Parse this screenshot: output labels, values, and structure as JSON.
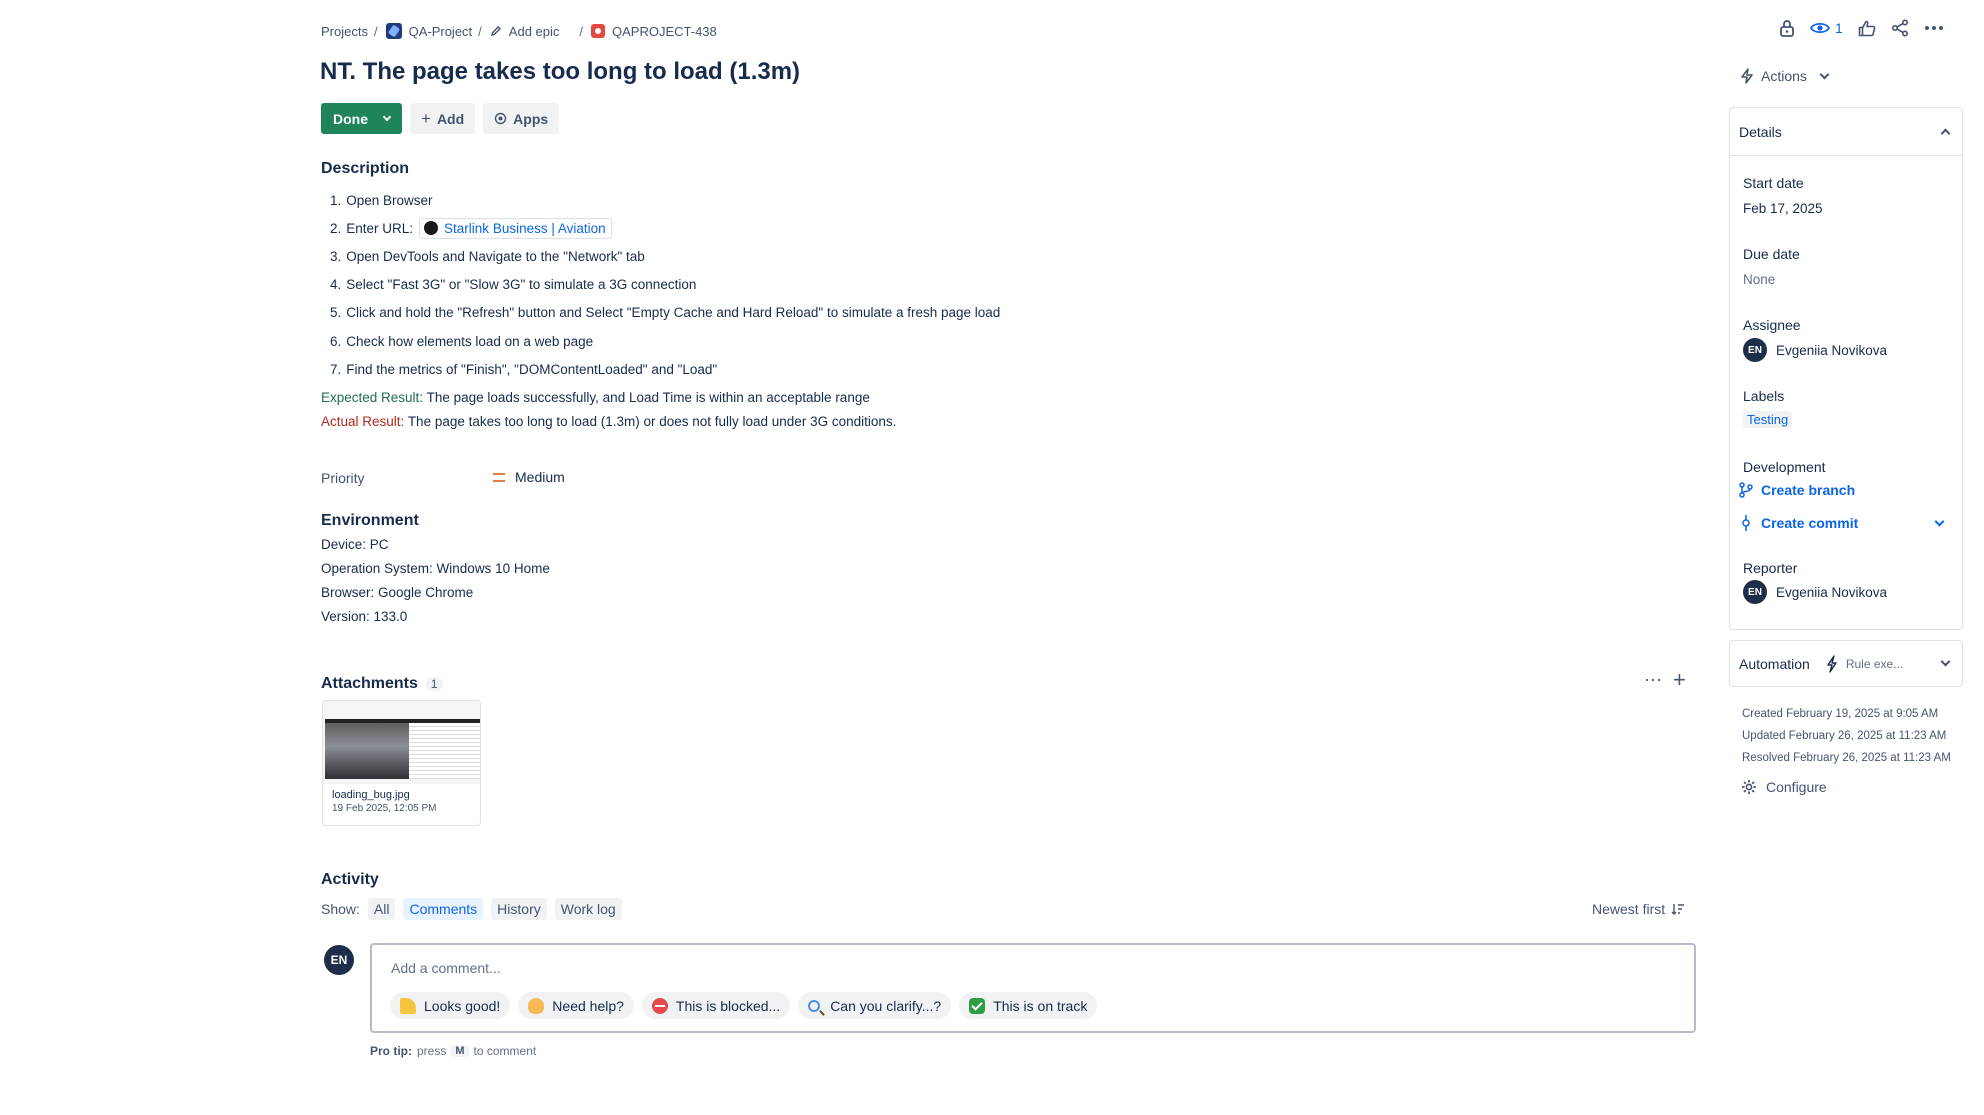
{
  "breadcrumb": {
    "projects": "Projects",
    "sep": "/",
    "project": "QA-Project",
    "add_epic": "Add epic",
    "issue_key": "QAPROJECT-438"
  },
  "issue": {
    "title": "NT. The page takes too long to load (1.3m)",
    "status": "Done",
    "add_label": "Add",
    "apps_label": "Apps"
  },
  "description": {
    "heading": "Description",
    "steps": [
      {
        "num": "1.",
        "text": "Open Browser"
      },
      {
        "num": "2.",
        "text": "Enter URL:",
        "link": "Starlink Business | Aviation"
      },
      {
        "num": "3.",
        "text": "Open DevTools and Navigate to the \"Network\" tab"
      },
      {
        "num": "4.",
        "text": "Select \"Fast 3G\" or \"Slow 3G\" to simulate a 3G connection"
      },
      {
        "num": "5.",
        "text": "Click and hold the \"Refresh\" button and Select \"Empty Cache and Hard Reload\" to simulate a fresh page load"
      },
      {
        "num": "6.",
        "text": "Check how elements load on a web page"
      },
      {
        "num": "7.",
        "text": "Find the metrics of \"Finish\", \"DOMContentLoaded\" and \"Load\""
      }
    ],
    "expected_label": "Expected Result:",
    "expected_text": "The page loads successfully, and Load Time is within an acceptable range",
    "actual_label": "Actual Result:",
    "actual_text": "The page takes too long to load (1.3m) or does not fully load under 3G conditions."
  },
  "priority": {
    "label": "Priority",
    "value": "Medium",
    "color": "#e2813f"
  },
  "environment": {
    "heading": "Environment",
    "lines": [
      "Device: PC",
      "Operation System: Windows 10 Home",
      "Browser: Google Chrome",
      "Version: 133.0"
    ]
  },
  "attachments": {
    "heading": "Attachments",
    "count": "1",
    "items": [
      {
        "name": "loading_bug.jpg",
        "date": "19 Feb 2025, 12:05 PM"
      }
    ]
  },
  "activity": {
    "heading": "Activity",
    "show_label": "Show:",
    "filters": [
      "All",
      "Comments",
      "History",
      "Work log"
    ],
    "selected_filter": "Comments",
    "sort_label": "Newest first",
    "avatar_initials": "EN",
    "comment_placeholder": "Add a comment...",
    "quick_replies": [
      {
        "label": "Looks good!",
        "icon": "party-popper-emoji"
      },
      {
        "label": "Need help?",
        "icon": "waving-hand-emoji"
      },
      {
        "label": "This is blocked...",
        "icon": "no-entry-emoji"
      },
      {
        "label": "Can you clarify...?",
        "icon": "magnifying-glass-emoji"
      },
      {
        "label": "This is on track",
        "icon": "check-mark-emoji"
      }
    ],
    "protip_label": "Pro tip:",
    "protip_press": "press",
    "protip_key": "M",
    "protip_suffix": "to comment"
  },
  "header_actions": {
    "watch_count": "1",
    "icons": [
      "lock-icon",
      "eye-icon",
      "thumbs-up-icon",
      "share-icon",
      "more-icon"
    ]
  },
  "sidebar": {
    "actions_label": "Actions",
    "details_heading": "Details",
    "start_date_label": "Start date",
    "start_date": "Feb 17, 2025",
    "due_date_label": "Due date",
    "due_date": "None",
    "assignee_label": "Assignee",
    "assignee_initials": "EN",
    "assignee": "Evgeniia Novikova",
    "labels_label": "Labels",
    "label_value": "Testing",
    "development_label": "Development",
    "create_branch": "Create branch",
    "create_commit": "Create commit",
    "reporter_label": "Reporter",
    "reporter_initials": "EN",
    "reporter": "Evgeniia Novikova",
    "automation_label": "Automation",
    "rule_label": "Rule exe...",
    "created": "Created February 19, 2025 at 9:05 AM",
    "updated": "Updated February 26, 2025 at 11:23 AM",
    "resolved": "Resolved February 26, 2025 at 11:23 AM",
    "configure": "Configure"
  },
  "colors": {
    "done_green": "#1f845a",
    "link_blue": "#0c66e4",
    "expected_green": "#216e4e",
    "actual_red": "#ae2a19"
  }
}
